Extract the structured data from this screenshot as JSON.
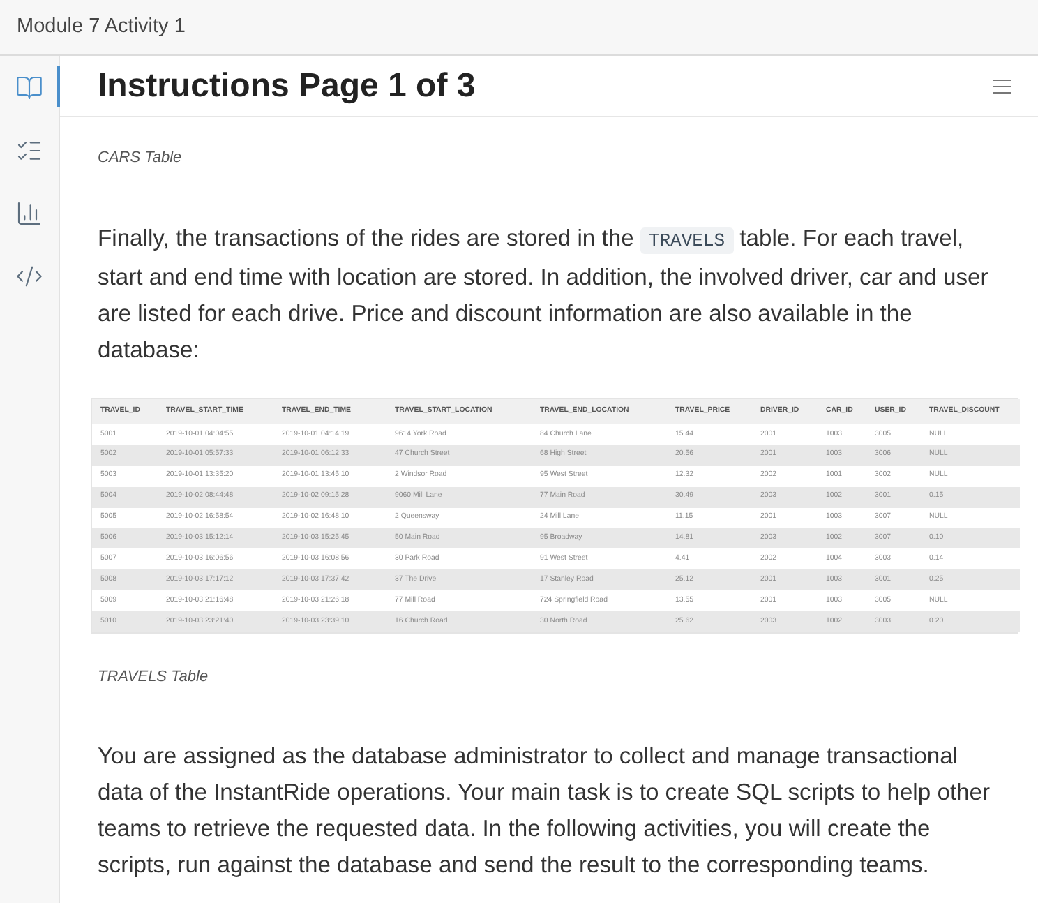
{
  "window": {
    "title": "Module 7 Activity 1"
  },
  "sidebar": {
    "items": [
      {
        "selected": true
      },
      {
        "selected": false
      },
      {
        "selected": false
      },
      {
        "selected": false
      }
    ]
  },
  "page": {
    "title": "Instructions Page 1 of 3"
  },
  "content": {
    "cars_caption": "CARS Table",
    "paragraph_1": {
      "before": "Finally, the transactions of the rides are stored in the ",
      "code": "TRAVELS",
      "after": " table. For each travel, start and end time with location are stored. In addition, the involved driver, car and user are listed for each drive. Price and discount information are also available in the database:"
    },
    "travels_table": {
      "columns": [
        "TRAVEL_ID",
        "TRAVEL_START_TIME",
        "TRAVEL_END_TIME",
        "TRAVEL_START_LOCATION",
        "TRAVEL_END_LOCATION",
        "TRAVEL_PRICE",
        "DRIVER_ID",
        "CAR_ID",
        "USER_ID",
        "TRAVEL_DISCOUNT"
      ],
      "rows": [
        [
          "5001",
          "2019-10-01 04:04:55",
          "2019-10-01 04:14:19",
          "9614 York Road",
          "84 Church Lane",
          "15.44",
          "2001",
          "1003",
          "3005",
          "NULL"
        ],
        [
          "5002",
          "2019-10-01 05:57:33",
          "2019-10-01 06:12:33",
          "47 Church Street",
          "68 High Street",
          "20.56",
          "2001",
          "1003",
          "3006",
          "NULL"
        ],
        [
          "5003",
          "2019-10-01 13:35:20",
          "2019-10-01 13:45:10",
          "2 Windsor Road",
          "95 West Street",
          "12.32",
          "2002",
          "1001",
          "3002",
          "NULL"
        ],
        [
          "5004",
          "2019-10-02 08:44:48",
          "2019-10-02 09:15:28",
          "9060 Mill Lane",
          "77 Main Road",
          "30.49",
          "2003",
          "1002",
          "3001",
          "0.15"
        ],
        [
          "5005",
          "2019-10-02 16:58:54",
          "2019-10-02 16:48:10",
          "2 Queensway",
          "24 Mill Lane",
          "11.15",
          "2001",
          "1003",
          "3007",
          "NULL"
        ],
        [
          "5006",
          "2019-10-03 15:12:14",
          "2019-10-03 15:25:45",
          "50 Main Road",
          "95 Broadway",
          "14.81",
          "2003",
          "1002",
          "3007",
          "0.10"
        ],
        [
          "5007",
          "2019-10-03 16:06:56",
          "2019-10-03 16:08:56",
          "30 Park Road",
          "91 West Street",
          "4.41",
          "2002",
          "1004",
          "3003",
          "0.14"
        ],
        [
          "5008",
          "2019-10-03 17:17:12",
          "2019-10-03 17:37:42",
          "37 The Drive",
          "17 Stanley Road",
          "25.12",
          "2001",
          "1003",
          "3001",
          "0.25"
        ],
        [
          "5009",
          "2019-10-03 21:16:48",
          "2019-10-03 21:26:18",
          "77 Mill Road",
          "724 Springfield Road",
          "13.55",
          "2001",
          "1003",
          "3005",
          "NULL"
        ],
        [
          "5010",
          "2019-10-03 23:21:40",
          "2019-10-03 23:39:10",
          "16 Church Road",
          "30 North Road",
          "25.62",
          "2003",
          "1002",
          "3003",
          "0.20"
        ]
      ]
    },
    "travels_caption": "TRAVELS Table",
    "paragraph_2": "You are assigned as the database administrator to collect and manage transactional data of the InstantRide operations. Your main task is to create SQL scripts to help other teams to retrieve the requested data. In the following activities, you will create the scripts, run against the database and send the result to the corresponding teams."
  }
}
